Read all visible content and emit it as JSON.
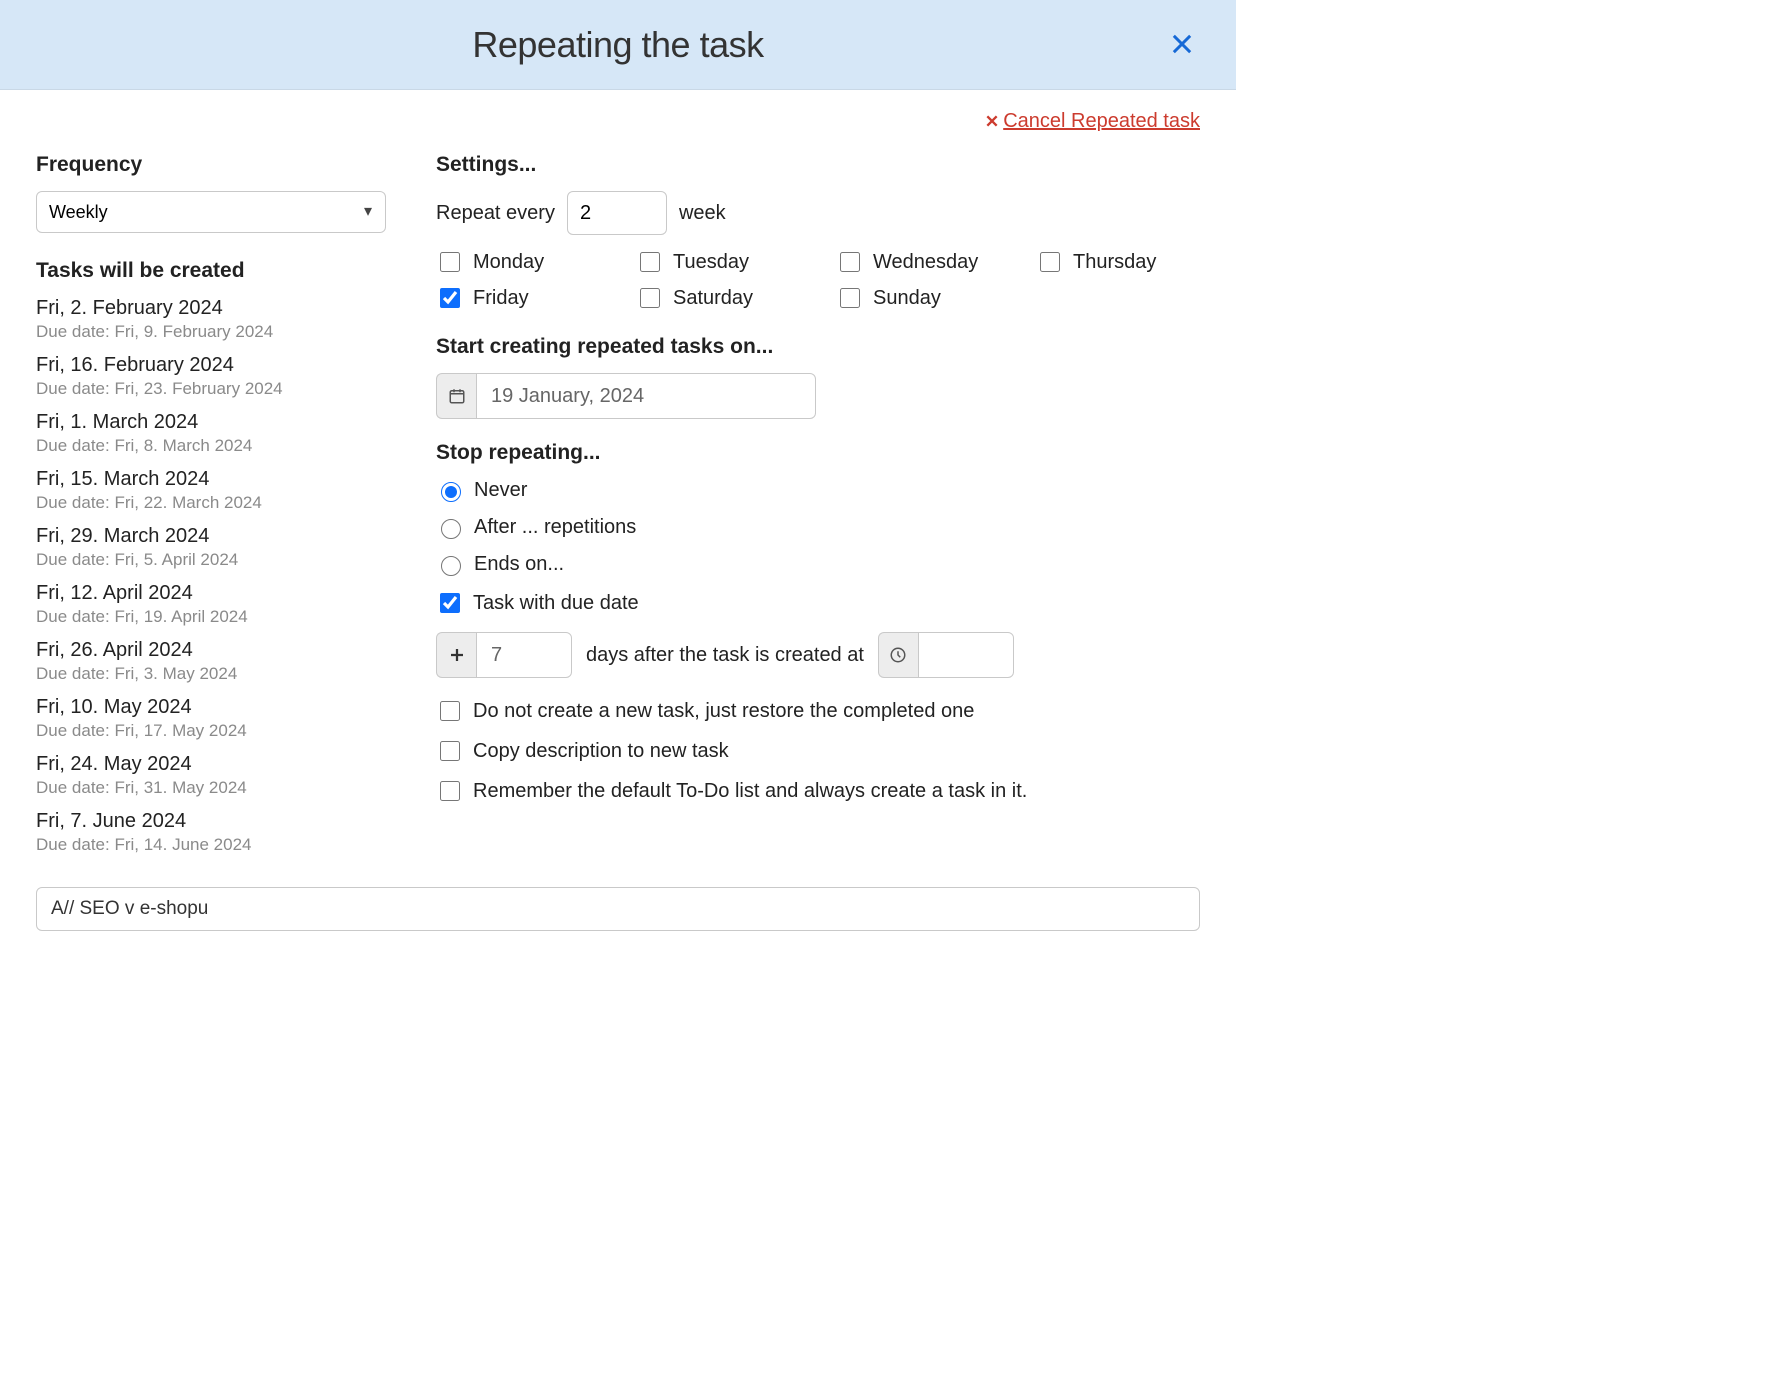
{
  "header": {
    "title": "Repeating the task"
  },
  "cancel_label": "Cancel Repeated task",
  "left": {
    "frequency_label": "Frequency",
    "frequency_value": "Weekly",
    "preview_label": "Tasks will be created",
    "due_prefix": "Due date: ",
    "tasks": [
      {
        "date": "Fri, 2. February 2024",
        "due": "Fri, 9. February 2024"
      },
      {
        "date": "Fri, 16. February 2024",
        "due": "Fri, 23. February 2024"
      },
      {
        "date": "Fri, 1. March 2024",
        "due": "Fri, 8. March 2024"
      },
      {
        "date": "Fri, 15. March 2024",
        "due": "Fri, 22. March 2024"
      },
      {
        "date": "Fri, 29. March 2024",
        "due": "Fri, 5. April 2024"
      },
      {
        "date": "Fri, 12. April 2024",
        "due": "Fri, 19. April 2024"
      },
      {
        "date": "Fri, 26. April 2024",
        "due": "Fri, 3. May 2024"
      },
      {
        "date": "Fri, 10. May 2024",
        "due": "Fri, 17. May 2024"
      },
      {
        "date": "Fri, 24. May 2024",
        "due": "Fri, 31. May 2024"
      },
      {
        "date": "Fri, 7. June 2024",
        "due": "Fri, 14. June 2024"
      }
    ]
  },
  "settings": {
    "heading": "Settings...",
    "repeat_every_label": "Repeat every",
    "repeat_every_value": "2",
    "repeat_every_unit": "week",
    "days": [
      {
        "label": "Monday",
        "checked": false
      },
      {
        "label": "Tuesday",
        "checked": false
      },
      {
        "label": "Wednesday",
        "checked": false
      },
      {
        "label": "Thursday",
        "checked": false
      },
      {
        "label": "Friday",
        "checked": true
      },
      {
        "label": "Saturday",
        "checked": false
      },
      {
        "label": "Sunday",
        "checked": false
      }
    ],
    "start_heading": "Start creating repeated tasks on...",
    "start_date": "19 January, 2024",
    "stop_heading": "Stop repeating...",
    "stop_options": {
      "never": "Never",
      "after": "After ... repetitions",
      "ends_on": "Ends on...",
      "selected": "never"
    },
    "due_check_label": "Task with due date",
    "due_check_checked": true,
    "due_days_value": "7",
    "due_days_suffix": "days after the task is created at",
    "due_time_value": "",
    "options": [
      {
        "label": "Do not create a new task, just restore the completed one",
        "checked": false
      },
      {
        "label": "Copy description to new task",
        "checked": false
      },
      {
        "label": "Remember the default To-Do list and always create a task in it.",
        "checked": false
      }
    ]
  },
  "bottom": {
    "value": "A// SEO v e-shopu"
  }
}
